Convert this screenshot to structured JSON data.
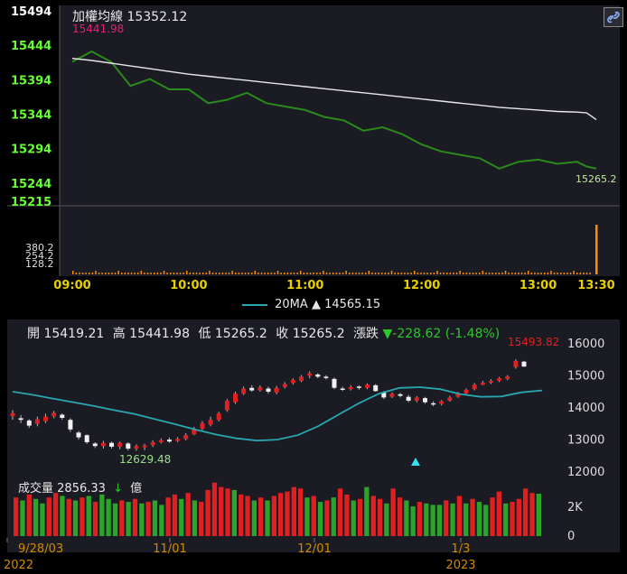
{
  "colors": {
    "background": "#000000",
    "panel": "#1b1b24",
    "index_line": "#2a8a1a",
    "avg_line": "#e8e8e8",
    "volume_bar": "#ff8c00",
    "up": "#e02020",
    "down": "#2aa52a",
    "ma20": "#2aa6b0",
    "axis_green": "#66ff33",
    "time_yellow": "#e8d000",
    "date_orange": "#d08a00"
  },
  "intraday": {
    "title": "加權均線 15352.12",
    "high_label": "15441.98",
    "last_label": "15265.2",
    "link_icon": "link-icon",
    "y_labels": [
      "15494",
      "15444",
      "15394",
      "15344",
      "15294",
      "15244",
      "15215"
    ],
    "vol_labels": [
      "380.2",
      "254.2",
      "128.2"
    ],
    "time_labels": [
      "09:00",
      "10:00",
      "11:00",
      "12:00",
      "13:00",
      "13:30"
    ]
  },
  "chart_data": [
    {
      "type": "line",
      "x": [
        "09:00",
        "09:10",
        "09:20",
        "09:30",
        "09:40",
        "09:50",
        "10:00",
        "10:10",
        "10:20",
        "10:30",
        "10:40",
        "10:50",
        "11:00",
        "11:10",
        "11:20",
        "11:30",
        "11:40",
        "11:50",
        "12:00",
        "12:10",
        "12:20",
        "12:30",
        "12:40",
        "12:50",
        "13:00",
        "13:10",
        "13:20",
        "13:25",
        "13:30"
      ],
      "series": [
        {
          "values": [
            15420,
            15435,
            15420,
            15385,
            15395,
            15380,
            15380,
            15360,
            15365,
            15375,
            15360,
            15355,
            15350,
            15340,
            15335,
            15320,
            15325,
            15315,
            15300,
            15290,
            15285,
            15280,
            15265,
            15275,
            15278,
            15272,
            15275,
            15268,
            15265
          ]
        },
        {
          "values": [
            15425,
            15422,
            15418,
            15414,
            15410,
            15406,
            15402,
            15399,
            15396,
            15393,
            15390,
            15387,
            15384,
            15381,
            15378,
            15375,
            15372,
            15369,
            15366,
            15363,
            15360,
            15357,
            15354,
            15352,
            15350,
            15348,
            15347,
            15346,
            15336
          ]
        }
      ],
      "ylim": [
        15215,
        15494
      ],
      "volume": {
        "x_last": "13:30",
        "last_value": 380.2
      }
    },
    {
      "type": "bar",
      "stats": {
        "open_label": "開",
        "open": "15419.21",
        "high_label": "高",
        "high": "15441.98",
        "low_label": "低",
        "low": "15265.2",
        "close_label": "收",
        "close": "15265.2",
        "change_label": "漲跌",
        "change": "-228.62 (-1.48%)"
      },
      "ma_legend": "20MA",
      "ma_value": "14565.15",
      "peak_label": "15493.82",
      "trough_label": "12629.48",
      "y_labels": [
        "16000",
        "15000",
        "14000",
        "13000",
        "12000"
      ],
      "ylim": [
        11600,
        16400
      ],
      "date_labels": [
        "9/28/03",
        "11/01",
        "12/01",
        "1/3"
      ],
      "year_labels": [
        "2022",
        "2023"
      ],
      "candles": [
        [
          13710,
          13810,
          13900,
          13600
        ],
        [
          13650,
          13600,
          13750,
          13500
        ],
        [
          13580,
          13420,
          13620,
          13350
        ],
        [
          13480,
          13620,
          13700,
          13400
        ],
        [
          13560,
          13700,
          13790,
          13500
        ],
        [
          13710,
          13820,
          13880,
          13650
        ],
        [
          13760,
          13660,
          13800,
          13600
        ],
        [
          13600,
          13300,
          13650,
          13220
        ],
        [
          13200,
          13050,
          13250,
          12980
        ],
        [
          13120,
          12900,
          13150,
          12850
        ],
        [
          12860,
          12780,
          12900,
          12720
        ],
        [
          12780,
          12880,
          12940,
          12700
        ],
        [
          12880,
          12760,
          12920,
          12700
        ],
        [
          12760,
          12880,
          12920,
          12680
        ],
        [
          12860,
          12700,
          12900,
          12640
        ],
        [
          12700,
          12780,
          12830,
          12630
        ],
        [
          12740,
          12800,
          12850,
          12650
        ],
        [
          12810,
          12900,
          12960,
          12750
        ],
        [
          12900,
          12960,
          13020,
          12860
        ],
        [
          12980,
          12920,
          13050,
          12880
        ],
        [
          12940,
          13000,
          13060,
          12900
        ],
        [
          13000,
          13120,
          13180,
          12960
        ],
        [
          13150,
          13300,
          13380,
          13120
        ],
        [
          13320,
          13500,
          13560,
          13280
        ],
        [
          13450,
          13600,
          13700,
          13400
        ],
        [
          13600,
          13800,
          13850,
          13550
        ],
        [
          13900,
          14200,
          14250,
          13850
        ],
        [
          14150,
          14420,
          14480,
          14100
        ],
        [
          14420,
          14580,
          14640,
          14380
        ],
        [
          14600,
          14520,
          14680,
          14480
        ],
        [
          14520,
          14620,
          14680,
          14480
        ],
        [
          14580,
          14480,
          14640,
          14420
        ],
        [
          14450,
          14600,
          14660,
          14400
        ],
        [
          14620,
          14720,
          14780,
          14580
        ],
        [
          14750,
          14850,
          14900,
          14700
        ],
        [
          14820,
          14950,
          15000,
          14780
        ],
        [
          14980,
          15050,
          15120,
          14900
        ],
        [
          15020,
          14950,
          15060,
          14900
        ],
        [
          14950,
          14920,
          15000,
          14860
        ],
        [
          14880,
          14600,
          14920,
          14560
        ],
        [
          14580,
          14560,
          14640,
          14500
        ],
        [
          14560,
          14620,
          14680,
          14520
        ],
        [
          14640,
          14600,
          14680,
          14540
        ],
        [
          14600,
          14700,
          14740,
          14560
        ],
        [
          14680,
          14500,
          14720,
          14480
        ],
        [
          14450,
          14300,
          14500,
          14250
        ],
        [
          14320,
          14420,
          14460,
          14280
        ],
        [
          14400,
          14350,
          14440,
          14300
        ],
        [
          14320,
          14200,
          14380,
          14150
        ],
        [
          14200,
          14300,
          14340,
          14150
        ],
        [
          14280,
          14150,
          14320,
          14100
        ],
        [
          14120,
          14080,
          14180,
          14030
        ],
        [
          14100,
          14180,
          14220,
          14050
        ],
        [
          14200,
          14300,
          14350,
          14170
        ],
        [
          14320,
          14420,
          14470,
          14290
        ],
        [
          14430,
          14540,
          14580,
          14400
        ],
        [
          14560,
          14700,
          14750,
          14520
        ],
        [
          14700,
          14760,
          14820,
          14680
        ],
        [
          14760,
          14820,
          14870,
          14720
        ],
        [
          14820,
          14900,
          14940,
          14780
        ],
        [
          14880,
          14960,
          15000,
          14840
        ],
        [
          15250,
          15440,
          15493,
          15200
        ],
        [
          15419,
          15265,
          15442,
          15265
        ]
      ],
      "ma20_points": [
        14480,
        14380,
        14260,
        14150,
        14030,
        13900,
        13780,
        13620,
        13460,
        13290,
        13140,
        13020,
        12950,
        12980,
        13120,
        13400,
        13760,
        14120,
        14420,
        14600,
        14620,
        14560,
        14400,
        14320,
        14330,
        14460,
        14520
      ],
      "volume": {
        "label": "成交量",
        "value": "2856.33",
        "unit": "億",
        "arrow": "↓",
        "y_labels": [
          "2K",
          "0"
        ],
        "ylim": [
          0,
          3400
        ],
        "values": [
          2600,
          2400,
          2800,
          2500,
          2200,
          2600,
          2900,
          2700,
          2500,
          2400,
          2600,
          2700,
          2300,
          2800,
          2500,
          2200,
          2400,
          2300,
          2500,
          2200,
          2300,
          2400,
          2100,
          2600,
          2800,
          2500,
          2900,
          2400,
          2300,
          3100,
          3600,
          3300,
          3200,
          3100,
          2800,
          2700,
          2400,
          2600,
          2400,
          2700,
          2900,
          3000,
          3300,
          3200,
          2600,
          2700,
          2300,
          2400,
          2600,
          3200,
          2800,
          2400,
          2500,
          3300,
          2700,
          2500,
          2200,
          3200,
          2600,
          2400,
          2000,
          2300,
          2200,
          2100,
          2100,
          2400,
          2200,
          2700,
          2200,
          2500,
          2300,
          2100,
          2600,
          3000,
          2200,
          2300,
          2500,
          3200,
          2900,
          2856
        ],
        "colors": [
          "up",
          "down",
          "up",
          "down",
          "down",
          "up",
          "up",
          "down",
          "up",
          "down",
          "up",
          "down",
          "up",
          "down",
          "down",
          "down",
          "up",
          "down",
          "up",
          "down",
          "up",
          "down",
          "down",
          "up",
          "up",
          "down",
          "up",
          "down",
          "up",
          "up",
          "up",
          "up",
          "up",
          "down",
          "up",
          "up",
          "down",
          "up",
          "down",
          "up",
          "up",
          "up",
          "up",
          "up",
          "down",
          "up",
          "down",
          "up",
          "down",
          "up",
          "up",
          "down",
          "up",
          "down",
          "up",
          "up",
          "down",
          "up",
          "up",
          "down",
          "down",
          "up",
          "down",
          "down",
          "down",
          "up",
          "down",
          "up",
          "down",
          "up",
          "down",
          "down",
          "up",
          "up",
          "down",
          "up",
          "up",
          "up",
          "up",
          "down"
        ]
      }
    }
  ]
}
